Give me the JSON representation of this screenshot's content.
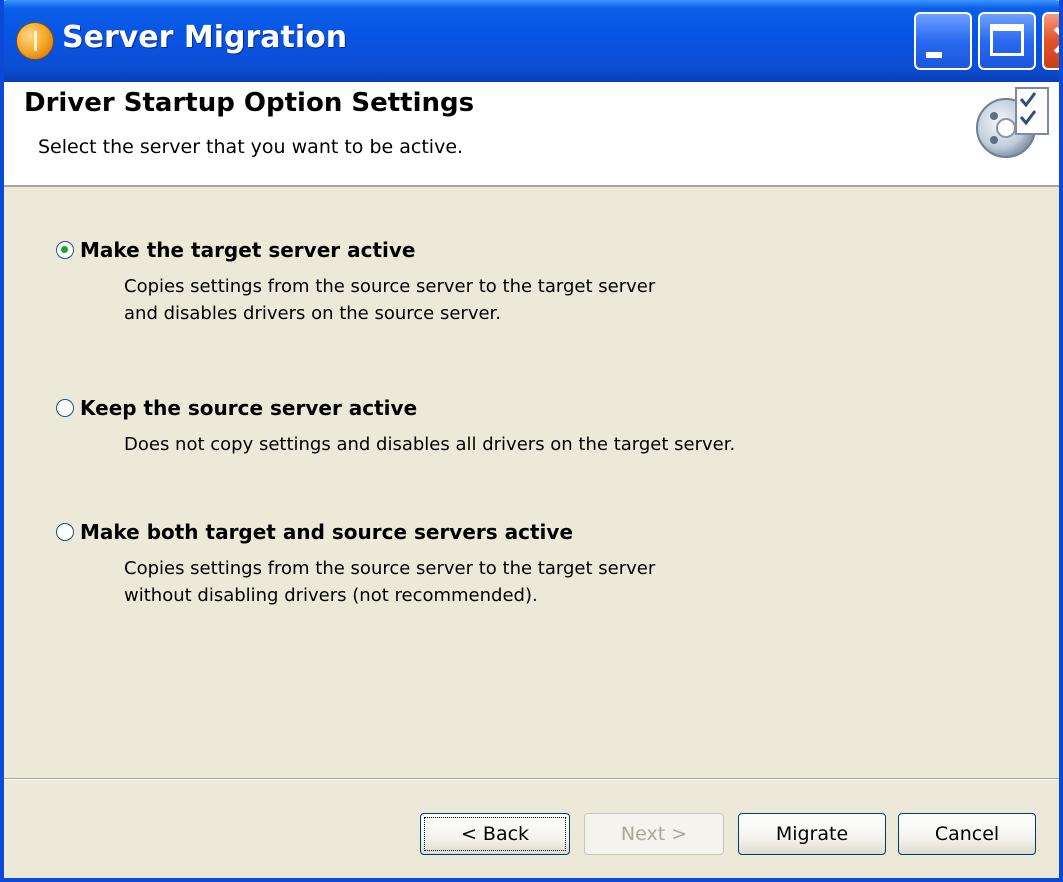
{
  "window": {
    "title": "Server Migration",
    "controls": {
      "minimize_icon": "minimize-icon",
      "maximize_icon": "maximize-icon",
      "close_icon": "close-icon",
      "close_glyph": "✕"
    }
  },
  "header": {
    "title": "Driver Startup Option Settings",
    "subtitle": "Select the server that you want to be active.",
    "graphic_icon": "settings-checklist-icon"
  },
  "options": [
    {
      "label": "Make the target server active",
      "selected": true,
      "description_lines": [
        "Copies settings from the source server to the target server",
        "and disables drivers on the source server."
      ]
    },
    {
      "label": "Keep the source server active",
      "selected": false,
      "description_lines": [
        "Does not copy settings and disables all drivers on the target server."
      ]
    },
    {
      "label": "Make both target and source servers active",
      "selected": false,
      "description_lines": [
        "Copies settings from the source server to the target server",
        "without disabling drivers (not recommended)."
      ]
    }
  ],
  "buttons": {
    "back": "< Back",
    "next": "Next >",
    "migrate": "Migrate",
    "cancel": "Cancel"
  },
  "colors": {
    "titlebar": "#0854e3",
    "dialog_background": "#ece9d8",
    "header_background": "#ffffff",
    "radio_selected": "#21a121"
  }
}
